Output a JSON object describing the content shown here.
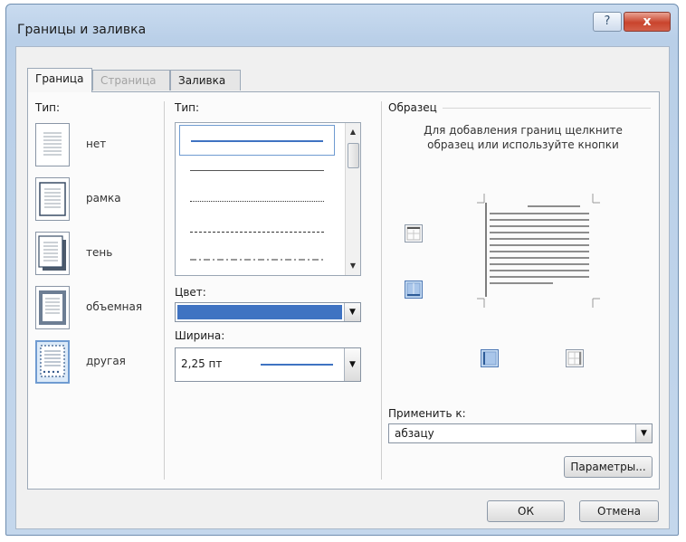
{
  "window": {
    "title": "Границы и заливка",
    "help_label": "?",
    "close_label": "x"
  },
  "tabs": [
    {
      "label": "Граница",
      "state": "active"
    },
    {
      "label": "Страница",
      "state": "disabled"
    },
    {
      "label": "Заливка",
      "state": "normal"
    }
  ],
  "presets": {
    "group_label": "Тип:",
    "items": [
      {
        "label": "нет",
        "icon": "border-none-icon"
      },
      {
        "label": "рамка",
        "icon": "border-box-icon"
      },
      {
        "label": "тень",
        "icon": "border-shadow-icon"
      },
      {
        "label": "объемная",
        "icon": "border-3d-icon"
      },
      {
        "label": "другая",
        "icon": "border-custom-icon",
        "selected": true
      }
    ]
  },
  "line_style": {
    "group_label": "Тип:",
    "options": [
      "solid",
      "solid-thin",
      "dotted",
      "dashed",
      "dash-dot"
    ],
    "selected": "solid"
  },
  "color": {
    "label": "Цвет:",
    "value_hex": "#3f73c2"
  },
  "width": {
    "label": "Ширина:",
    "value": "2,25 пт"
  },
  "preview": {
    "group_label": "Образец",
    "hint": "Для добавления границ щелкните образец или используйте кнопки"
  },
  "apply_to": {
    "label": "Применить к:",
    "value": "абзацу"
  },
  "buttons": {
    "options": "Параметры...",
    "ok": "ОК",
    "cancel": "Отмена"
  },
  "colors": {
    "accent": "#3f73c2",
    "selection_border": "#6f9bd1",
    "close_red": "#c9442d"
  }
}
